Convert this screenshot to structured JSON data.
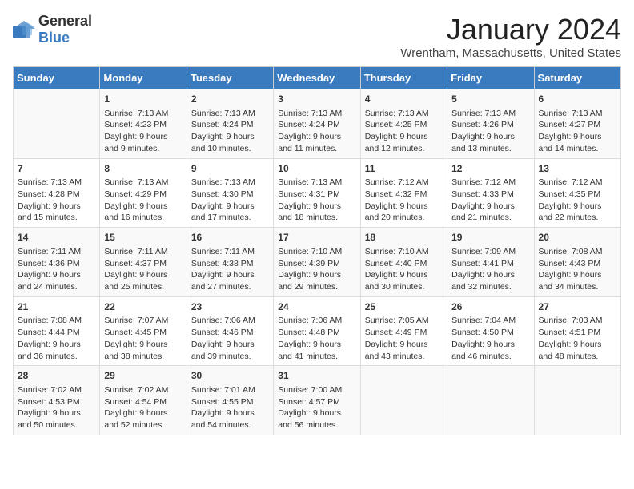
{
  "logo": {
    "general": "General",
    "blue": "Blue"
  },
  "header": {
    "month_year": "January 2024",
    "location": "Wrentham, Massachusetts, United States"
  },
  "days_of_week": [
    "Sunday",
    "Monday",
    "Tuesday",
    "Wednesday",
    "Thursday",
    "Friday",
    "Saturday"
  ],
  "weeks": [
    [
      {
        "day": "",
        "content": ""
      },
      {
        "day": "1",
        "content": "Sunrise: 7:13 AM\nSunset: 4:23 PM\nDaylight: 9 hours\nand 9 minutes."
      },
      {
        "day": "2",
        "content": "Sunrise: 7:13 AM\nSunset: 4:24 PM\nDaylight: 9 hours\nand 10 minutes."
      },
      {
        "day": "3",
        "content": "Sunrise: 7:13 AM\nSunset: 4:24 PM\nDaylight: 9 hours\nand 11 minutes."
      },
      {
        "day": "4",
        "content": "Sunrise: 7:13 AM\nSunset: 4:25 PM\nDaylight: 9 hours\nand 12 minutes."
      },
      {
        "day": "5",
        "content": "Sunrise: 7:13 AM\nSunset: 4:26 PM\nDaylight: 9 hours\nand 13 minutes."
      },
      {
        "day": "6",
        "content": "Sunrise: 7:13 AM\nSunset: 4:27 PM\nDaylight: 9 hours\nand 14 minutes."
      }
    ],
    [
      {
        "day": "7",
        "content": "Sunrise: 7:13 AM\nSunset: 4:28 PM\nDaylight: 9 hours\nand 15 minutes."
      },
      {
        "day": "8",
        "content": "Sunrise: 7:13 AM\nSunset: 4:29 PM\nDaylight: 9 hours\nand 16 minutes."
      },
      {
        "day": "9",
        "content": "Sunrise: 7:13 AM\nSunset: 4:30 PM\nDaylight: 9 hours\nand 17 minutes."
      },
      {
        "day": "10",
        "content": "Sunrise: 7:13 AM\nSunset: 4:31 PM\nDaylight: 9 hours\nand 18 minutes."
      },
      {
        "day": "11",
        "content": "Sunrise: 7:12 AM\nSunset: 4:32 PM\nDaylight: 9 hours\nand 20 minutes."
      },
      {
        "day": "12",
        "content": "Sunrise: 7:12 AM\nSunset: 4:33 PM\nDaylight: 9 hours\nand 21 minutes."
      },
      {
        "day": "13",
        "content": "Sunrise: 7:12 AM\nSunset: 4:35 PM\nDaylight: 9 hours\nand 22 minutes."
      }
    ],
    [
      {
        "day": "14",
        "content": "Sunrise: 7:11 AM\nSunset: 4:36 PM\nDaylight: 9 hours\nand 24 minutes."
      },
      {
        "day": "15",
        "content": "Sunrise: 7:11 AM\nSunset: 4:37 PM\nDaylight: 9 hours\nand 25 minutes."
      },
      {
        "day": "16",
        "content": "Sunrise: 7:11 AM\nSunset: 4:38 PM\nDaylight: 9 hours\nand 27 minutes."
      },
      {
        "day": "17",
        "content": "Sunrise: 7:10 AM\nSunset: 4:39 PM\nDaylight: 9 hours\nand 29 minutes."
      },
      {
        "day": "18",
        "content": "Sunrise: 7:10 AM\nSunset: 4:40 PM\nDaylight: 9 hours\nand 30 minutes."
      },
      {
        "day": "19",
        "content": "Sunrise: 7:09 AM\nSunset: 4:41 PM\nDaylight: 9 hours\nand 32 minutes."
      },
      {
        "day": "20",
        "content": "Sunrise: 7:08 AM\nSunset: 4:43 PM\nDaylight: 9 hours\nand 34 minutes."
      }
    ],
    [
      {
        "day": "21",
        "content": "Sunrise: 7:08 AM\nSunset: 4:44 PM\nDaylight: 9 hours\nand 36 minutes."
      },
      {
        "day": "22",
        "content": "Sunrise: 7:07 AM\nSunset: 4:45 PM\nDaylight: 9 hours\nand 38 minutes."
      },
      {
        "day": "23",
        "content": "Sunrise: 7:06 AM\nSunset: 4:46 PM\nDaylight: 9 hours\nand 39 minutes."
      },
      {
        "day": "24",
        "content": "Sunrise: 7:06 AM\nSunset: 4:48 PM\nDaylight: 9 hours\nand 41 minutes."
      },
      {
        "day": "25",
        "content": "Sunrise: 7:05 AM\nSunset: 4:49 PM\nDaylight: 9 hours\nand 43 minutes."
      },
      {
        "day": "26",
        "content": "Sunrise: 7:04 AM\nSunset: 4:50 PM\nDaylight: 9 hours\nand 46 minutes."
      },
      {
        "day": "27",
        "content": "Sunrise: 7:03 AM\nSunset: 4:51 PM\nDaylight: 9 hours\nand 48 minutes."
      }
    ],
    [
      {
        "day": "28",
        "content": "Sunrise: 7:02 AM\nSunset: 4:53 PM\nDaylight: 9 hours\nand 50 minutes."
      },
      {
        "day": "29",
        "content": "Sunrise: 7:02 AM\nSunset: 4:54 PM\nDaylight: 9 hours\nand 52 minutes."
      },
      {
        "day": "30",
        "content": "Sunrise: 7:01 AM\nSunset: 4:55 PM\nDaylight: 9 hours\nand 54 minutes."
      },
      {
        "day": "31",
        "content": "Sunrise: 7:00 AM\nSunset: 4:57 PM\nDaylight: 9 hours\nand 56 minutes."
      },
      {
        "day": "",
        "content": ""
      },
      {
        "day": "",
        "content": ""
      },
      {
        "day": "",
        "content": ""
      }
    ]
  ]
}
